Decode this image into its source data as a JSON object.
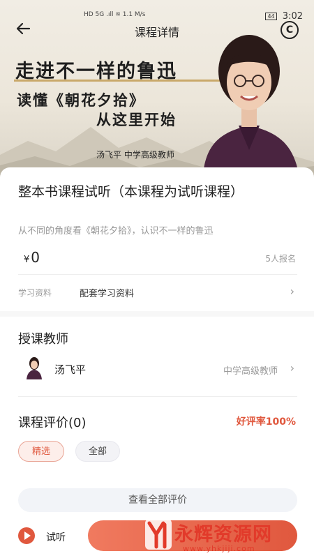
{
  "status_bar": {
    "left": "HD 5G .ıll ≋ 1.1 M/s",
    "battery": "44",
    "time": "3:02"
  },
  "nav": {
    "title": "课程详情",
    "back_icon": "arrow-left-icon",
    "logo": "C"
  },
  "poster": {
    "line1": "走进不一样的鲁迅",
    "line2": "读懂《朝花夕拾》",
    "line3": "从这里开始",
    "teacher": "汤飞平  中学高级教师"
  },
  "course": {
    "title": "整本书课程试听（本课程为试听课程）",
    "subtitle": "从不同的角度看《朝花夕拾》，认识不一样的鲁迅",
    "currency": "¥",
    "price": "0",
    "enrolled": "5人报名"
  },
  "materials": {
    "label": "学习资料",
    "value": "配套学习资料"
  },
  "teacher_section": {
    "title": "授课教师",
    "name": "汤飞平",
    "level": "中学高级教师"
  },
  "reviews": {
    "title": "课程评价(0)",
    "rating": "好评率100%",
    "chips": [
      "精选",
      "全部"
    ],
    "view_all": "查看全部评价"
  },
  "bottom": {
    "trial_label": "试听"
  },
  "watermark": {
    "title": "永辉资源网",
    "url": "www.yhkjiji.com"
  },
  "colors": {
    "accent": "#e0583e",
    "muted": "#999999"
  }
}
